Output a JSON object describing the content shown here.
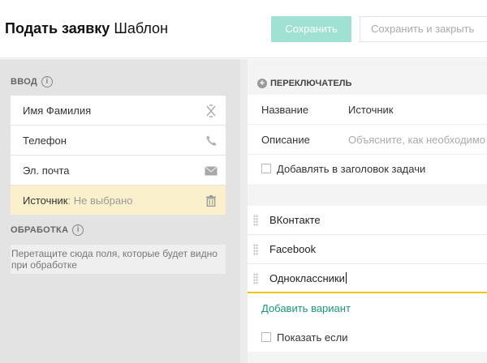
{
  "header": {
    "title_bold": "Подать заявку",
    "title_rest": "Шаблон",
    "save_label": "Сохранить",
    "save_close_label": "Сохранить и закрыть"
  },
  "left": {
    "input_section": "ВВОД",
    "fields": [
      {
        "label": "Имя Фамилия",
        "icon": "name-format-icon"
      },
      {
        "label": "Телефон",
        "icon": "phone-icon"
      },
      {
        "label": "Эл. почта",
        "icon": "envelope-icon"
      },
      {
        "label": "Источник",
        "sub": ": Не выбрано",
        "icon": "trash-icon"
      }
    ],
    "processing_section": "ОБРАБОТКА",
    "drop_hint": "Перетащите сюда поля, которые будет видно при обработке"
  },
  "right": {
    "section_title": "ПЕРЕКЛЮЧАТЕЛЬ",
    "name_label": "Название",
    "name_value": "Источник",
    "desc_label": "Описание",
    "desc_placeholder": "Объясните, как необходимо заполнить",
    "add_to_header": "Добавлять в заголовок задачи",
    "options": [
      "ВКонтакте",
      "Facebook",
      "Одноклассники"
    ],
    "add_option": "Добавить вариант",
    "show_if": "Показать если"
  },
  "colors": {
    "accent": "#9fe1d3",
    "link": "#17997a",
    "selected_field": "#fbf0cc",
    "active_underline": "#f2c200"
  }
}
